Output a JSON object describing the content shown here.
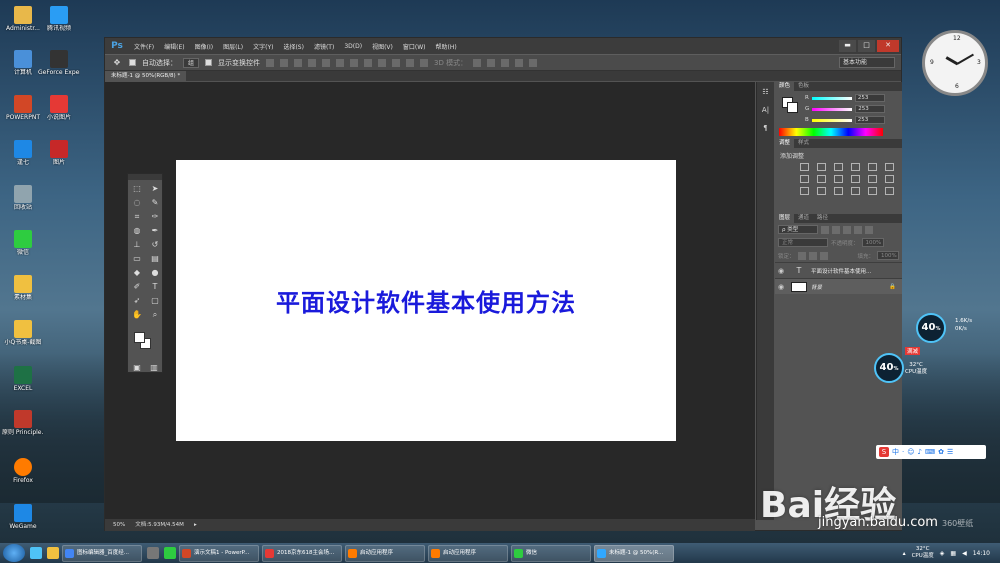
{
  "desktop": {
    "icons": [
      {
        "label": "Administr...",
        "color": "#e8b84a"
      },
      {
        "label": "腾讯视频",
        "color": "#2a9df4"
      },
      {
        "label": "计算机",
        "color": "#4a90d9"
      },
      {
        "label": "GeForce Experience",
        "color": "#76b900"
      },
      {
        "label": "POWERPNT",
        "color": "#d24726"
      },
      {
        "label": "小说图片",
        "color": "#e53935"
      },
      {
        "label": "逢七",
        "color": "#1e88e5"
      },
      {
        "label": "图片",
        "color": "#c62828"
      },
      {
        "label": "回收站",
        "color": "#90a4ae"
      },
      {
        "label": "微信",
        "color": "#2ecc40"
      },
      {
        "label": "素材集",
        "color": "#f0c040"
      },
      {
        "label": "小Q书桌-截图",
        "color": "#f0c040"
      },
      {
        "label": "EXCEL",
        "color": "#1e7145"
      },
      {
        "label": "原则 Principle...",
        "color": "#c0392b"
      },
      {
        "label": "Firefox",
        "color": "#ff7b00"
      },
      {
        "label": "WeGame",
        "color": "#1e88e5"
      }
    ]
  },
  "photoshop": {
    "logo": "Ps",
    "menu": [
      "文件(F)",
      "编辑(E)",
      "图像(I)",
      "图层(L)",
      "文字(Y)",
      "选择(S)",
      "滤镜(T)",
      "3D(D)",
      "视图(V)",
      "窗口(W)",
      "帮助(H)"
    ],
    "window_controls": {
      "minimize": "▬",
      "maximize": "□",
      "close": "✕"
    },
    "options_bar": {
      "auto_select_label": "自动选择：",
      "auto_select_value": "组",
      "show_transform_label": "显示变换控件",
      "mode_3d_label": "3D 模式：",
      "workspace": "基本功能"
    },
    "document_tab": "未标题-1 @ 50%(RGB/8) *",
    "canvas_text": "平面设计软件基本使用方法",
    "status": {
      "zoom": "50%",
      "doc_size": "文档:5.93M/4.54M"
    },
    "color_panel": {
      "tabs": [
        "颜色",
        "色板"
      ],
      "r": "253",
      "g": "253",
      "b": "253"
    },
    "adjustments_panel": {
      "tabs": [
        "调整",
        "样式"
      ],
      "title": "添加调整"
    },
    "layers_panel": {
      "tabs": [
        "图层",
        "通道",
        "路径"
      ],
      "kind_filter": "ρ 类型",
      "blend_mode": "正常",
      "opacity_label": "不透明度：",
      "opacity_value": "100%",
      "lock_label": "锁定：",
      "fill_label": "填充：",
      "fill_value": "100%",
      "layers": [
        {
          "name": "平面设计软件基本使用...",
          "type": "text"
        },
        {
          "name": "背景",
          "type": "background"
        }
      ]
    }
  },
  "widgets": {
    "gauge_top": "40",
    "gauge_bottom": "40",
    "gauge_unit": "%",
    "speed_up": "1.6K/s",
    "speed_down": "0K/s",
    "cpu_badge": "满减",
    "cpu_temp": "32°C",
    "cpu_label": "CPU温度"
  },
  "watermark": {
    "logo": "Bai经验",
    "url": "jingyan.baidu.com",
    "wallpaper": "360壁纸"
  },
  "taskbar": {
    "items": [
      {
        "label": "图标编辑器_百度经...",
        "color": "#4285f4"
      },
      {
        "label": "演示文稿1 - PowerP...",
        "color": "#d24726"
      },
      {
        "label": "2018京东618主会场...",
        "color": "#e53935"
      },
      {
        "label": "启动应用程序",
        "color": "#ff7b00"
      },
      {
        "label": "启动应用程序",
        "color": "#ff7b00"
      },
      {
        "label": "微信",
        "color": "#2ecc40"
      },
      {
        "label": "未标题-1 @ 50%(R...",
        "color": "#31a8ff"
      }
    ],
    "temp": "32°C",
    "temp_label": "CPU温度",
    "time": "14:10"
  },
  "colors": {
    "ps_blue": "#31a8ff",
    "canvas_text": "#1a1adb"
  }
}
